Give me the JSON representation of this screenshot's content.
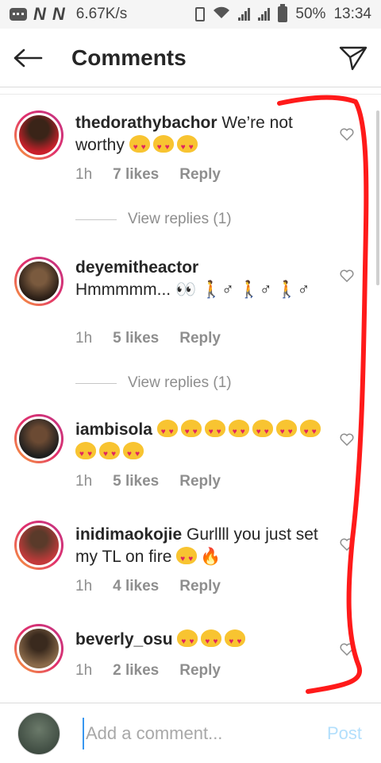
{
  "status_bar": {
    "net_letters": [
      "N",
      "N"
    ],
    "speed": "6.67K/s",
    "battery": "50%",
    "time": "13:34"
  },
  "header": {
    "title": "Comments",
    "back_icon": "back-arrow-icon",
    "send_icon": "direct-send-icon"
  },
  "comments": [
    {
      "user": "thedorathybachor",
      "text": "We’re not worthy",
      "emoji_count": 3,
      "time": "1h",
      "likes": "7 likes",
      "reply": "Reply",
      "view_replies": "View replies (1)",
      "avatar_color": "#c8202a"
    },
    {
      "user": "deyemitheactor",
      "text": "Hmmmmm... 👀 🚶♂ 🚶♂ 🚶♂",
      "emoji_count": 0,
      "time": "1h",
      "likes": "5 likes",
      "reply": "Reply",
      "view_replies": "View replies (1)",
      "avatar_color": "#3a2a1e"
    },
    {
      "user": "iambisola",
      "text": "",
      "emoji_count": 10,
      "time": "1h",
      "likes": "5 likes",
      "reply": "Reply",
      "avatar_color": "#2b2b2b"
    },
    {
      "user": "inidimaokojie",
      "text": "Gurllll you just set my TL on fire",
      "emoji_count": 1,
      "extra": "🔥",
      "time": "1h",
      "likes": "4 likes",
      "reply": "Reply",
      "avatar_color": "#c23a3a"
    },
    {
      "user": "beverly_osu",
      "text": "",
      "emoji_count": 3,
      "time": "1h",
      "likes": "2 likes",
      "reply": "Reply",
      "avatar_color": "#5a3b22"
    }
  ],
  "composer": {
    "placeholder": "Add a comment...",
    "post_label": "Post"
  },
  "colors": {
    "link_blue": "#3897f0",
    "muted": "#8e8e8e",
    "annotation_red": "#ff1a1a"
  }
}
